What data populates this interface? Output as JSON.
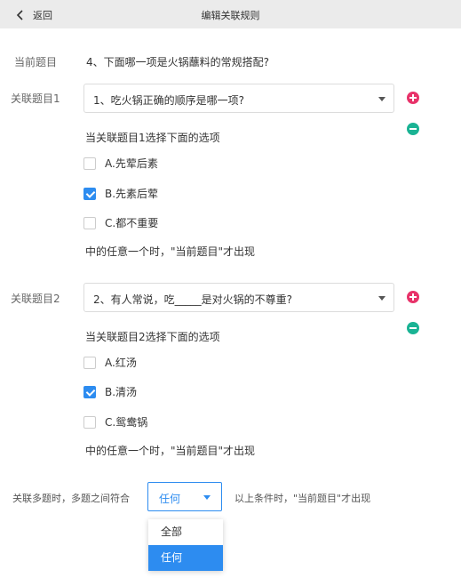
{
  "header": {
    "back_label": "返回",
    "title": "编辑关联规则"
  },
  "current": {
    "label": "当前题目",
    "question": "4、下面哪一项是火锅蘸料的常规搭配?"
  },
  "colors": {
    "add": "#e8336a",
    "remove": "#1ab394",
    "accent": "#2d8cf0"
  },
  "rules": [
    {
      "label": "关联题目1",
      "question": "1、吃火锅正确的顺序是哪一项?",
      "subtitle": "当关联题目1选择下面的选项",
      "options": [
        {
          "text": "A.先荤后素",
          "checked": false
        },
        {
          "text": "B.先素后荤",
          "checked": true
        },
        {
          "text": "C.都不重要",
          "checked": false
        }
      ],
      "footer": "中的任意一个时，\"当前题目\"才出现"
    },
    {
      "label": "关联题目2",
      "question": "2、有人常说，吃_____是对火锅的不尊重?",
      "subtitle": "当关联题目2选择下面的选项",
      "options": [
        {
          "text": "A.红汤",
          "checked": false
        },
        {
          "text": "B.清汤",
          "checked": true
        },
        {
          "text": "C.鸳鸯锅",
          "checked": false
        }
      ],
      "footer": "中的任意一个时，\"当前题目\"才出现"
    }
  ],
  "multi": {
    "prefix": "关联多题时，多题之间符合",
    "selected": "任何",
    "suffix": "以上条件时，\"当前题目\"才出现",
    "options": [
      "全部",
      "任何"
    ]
  }
}
